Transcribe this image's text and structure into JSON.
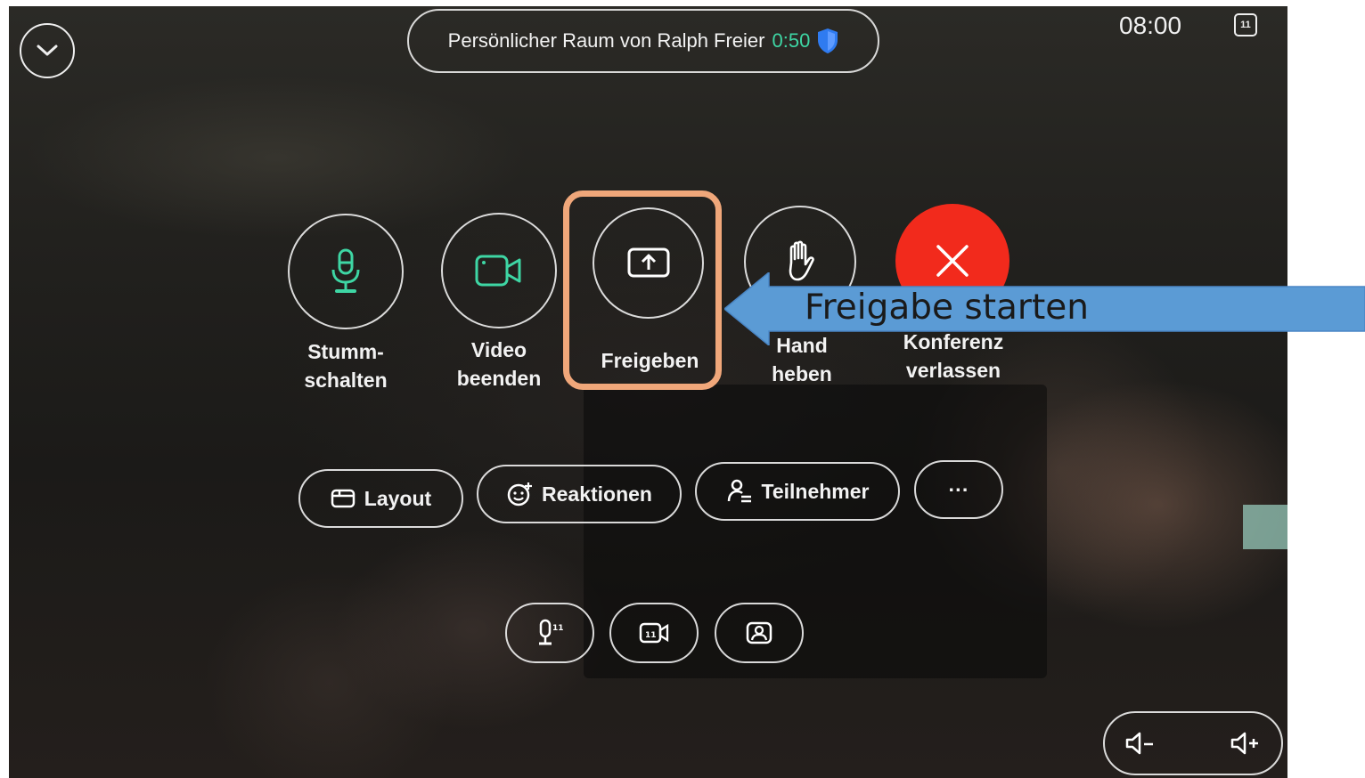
{
  "top_bar": {
    "room_title": "Persönlicher Raum von Ralph Freier",
    "call_timer": "0:50",
    "clock": "08:00",
    "security_icon": "shield-icon",
    "collapse_icon": "chevron-down-icon",
    "status_icon_text": "11"
  },
  "controls": [
    {
      "label": "Stumm-\nschalten",
      "icon": "microphone-icon",
      "icon_color": "#3ed6a4"
    },
    {
      "label": "Video\nbeenden",
      "icon": "video-camera-icon",
      "icon_color": "#3ed6a4"
    },
    {
      "label": "Freigeben",
      "icon": "share-screen-icon",
      "icon_color": "#ffffff"
    },
    {
      "label": "Hand\nheben",
      "icon": "raise-hand-icon",
      "icon_color": "#ffffff"
    },
    {
      "label": "Konferenz\nverlassen",
      "icon": "close-icon",
      "icon_color": "#ffffff",
      "background": "#f22a1c"
    }
  ],
  "secondary_buttons": [
    {
      "label": "Layout",
      "icon": "layout-icon"
    },
    {
      "label": "Reaktionen",
      "icon": "reactions-icon"
    },
    {
      "label": "Teilnehmer",
      "icon": "participants-icon"
    },
    {
      "label": "···",
      "icon": "more-icon"
    }
  ],
  "device_buttons": [
    {
      "icon": "microphone-settings-icon"
    },
    {
      "icon": "camera-settings-icon"
    },
    {
      "icon": "self-view-icon"
    }
  ],
  "volume": {
    "down_icon": "volume-down-icon",
    "up_icon": "volume-up-icon"
  },
  "annotation": {
    "text": "Freigabe starten",
    "arrow_color": "#5b9bd5",
    "highlight_color": "#f0a77a"
  }
}
